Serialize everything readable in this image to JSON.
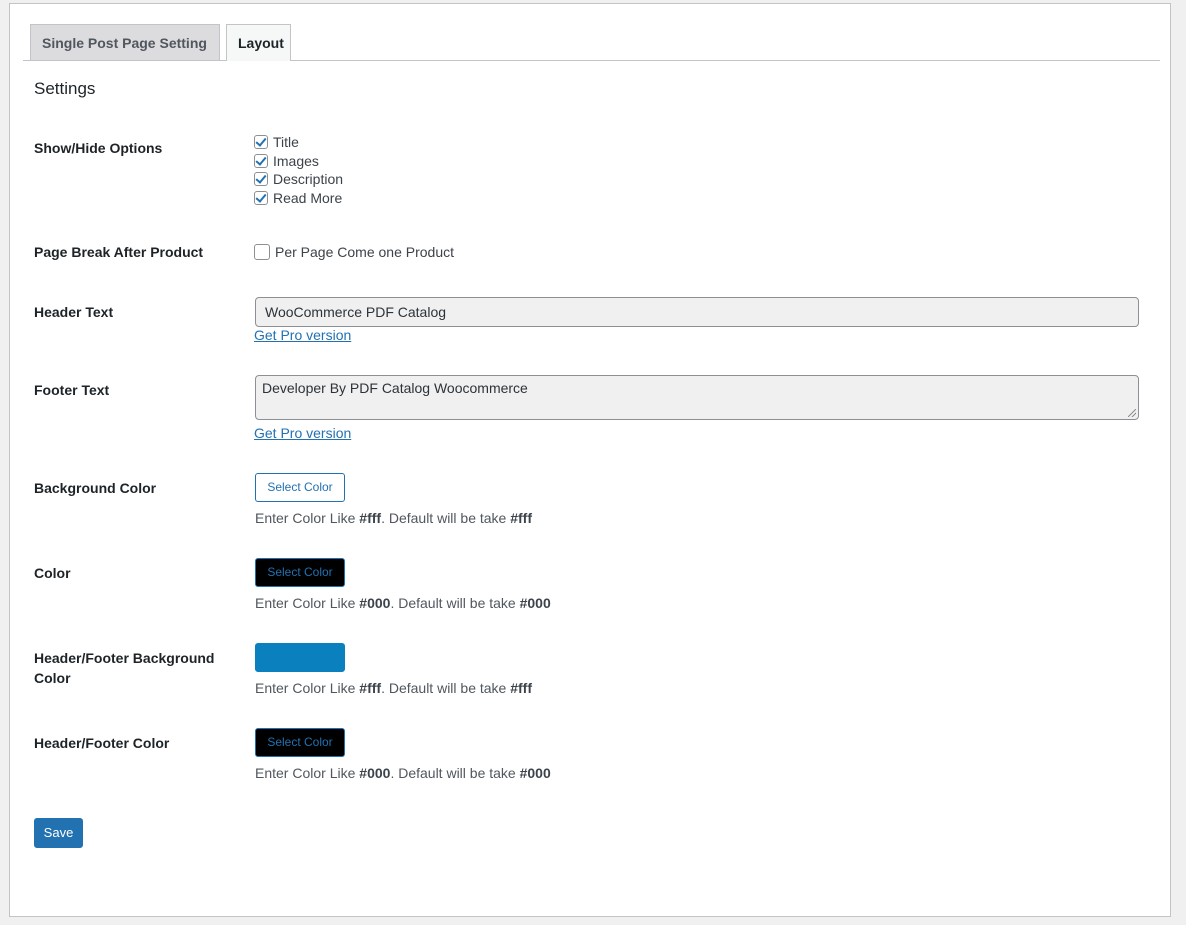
{
  "tabs": [
    {
      "label": "Single Post Page Setting"
    },
    {
      "label": "Layout"
    }
  ],
  "settings": {
    "title": "Settings",
    "show_hide": {
      "label": "Show/Hide Options",
      "options": [
        {
          "label": "Title",
          "checked": true
        },
        {
          "label": "Images",
          "checked": true
        },
        {
          "label": "Description",
          "checked": true
        },
        {
          "label": "Read More",
          "checked": true
        }
      ]
    },
    "page_break": {
      "label": "Page Break After Product",
      "option": {
        "label": "Per Page Come one Product",
        "checked": false
      }
    },
    "header_text": {
      "label": "Header Text",
      "value": "WooCommerce PDF Catalog",
      "link": "Get Pro version"
    },
    "footer_text": {
      "label": "Footer Text",
      "value": "Developer By PDF Catalog Woocommerce",
      "link": "Get Pro version"
    },
    "background_color": {
      "label": "Background Color",
      "button": "Select Color",
      "button_color": "#ffffff",
      "hint_prefix": "Enter Color Like ",
      "hint_example": "#fff",
      "hint_mid": ". Default will be take ",
      "hint_default": "#fff"
    },
    "color": {
      "label": "Color",
      "button": "Select Color",
      "button_color": "#000000",
      "hint_prefix": "Enter Color Like ",
      "hint_example": "#000",
      "hint_mid": ". Default will be take ",
      "hint_default": "#000"
    },
    "header_footer_bg": {
      "label": "Header/Footer Background Color",
      "button": "",
      "button_color": "#0a80bf",
      "hint_prefix": "Enter Color Like ",
      "hint_example": "#fff",
      "hint_mid": ". Default will be take ",
      "hint_default": "#fff"
    },
    "header_footer_color": {
      "label": "Header/Footer Color",
      "button": "Select Color",
      "button_color": "#000000",
      "hint_prefix": "Enter Color Like ",
      "hint_example": "#000",
      "hint_mid": ". Default will be take ",
      "hint_default": "#000"
    },
    "save_label": "Save"
  },
  "colors": {
    "accent": "#2271b1"
  }
}
